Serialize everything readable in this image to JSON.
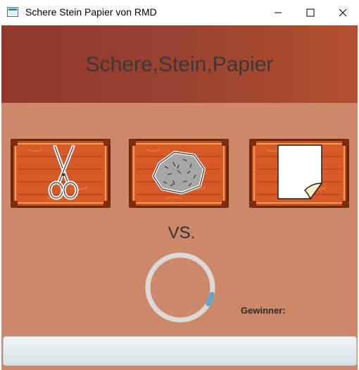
{
  "window": {
    "title": "Schere Stein Papier von RMD"
  },
  "header": {
    "title": "Schere,Stein,Papier"
  },
  "choices": [
    {
      "name": "Schere",
      "icon": "scissors-icon"
    },
    {
      "name": "Stein",
      "icon": "rock-icon"
    },
    {
      "name": "Papier",
      "icon": "paper-icon"
    }
  ],
  "vs_label": "VS.",
  "timer": {
    "progress": 0.05
  },
  "winner": {
    "label": "Gewinner:",
    "value": ""
  },
  "result": {
    "text": ""
  },
  "colors": {
    "background": "#cd8869",
    "header_start": "#913a2b",
    "header_end": "#b34f2e",
    "wood": "#c44d22",
    "timer_track": "#d9d9d9",
    "timer_progress": "#5aa7d6"
  }
}
